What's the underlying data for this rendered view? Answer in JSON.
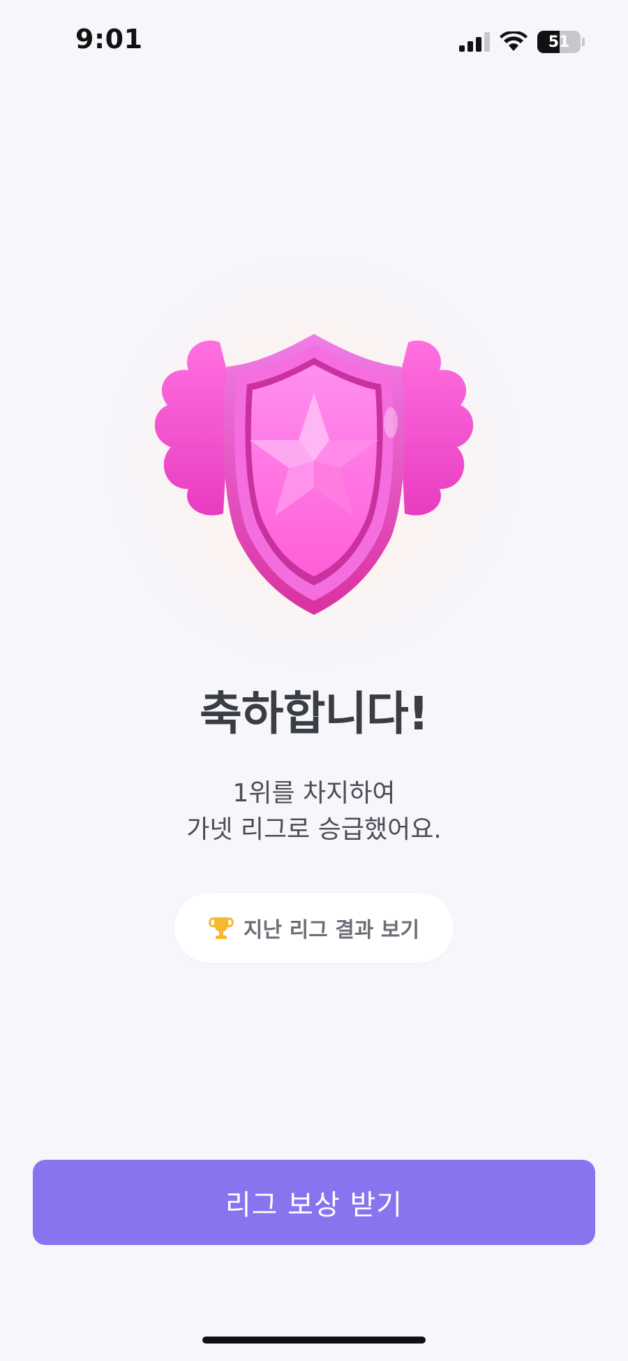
{
  "status_bar": {
    "time": "9:01",
    "battery_percent": "51",
    "battery_level": 0.51,
    "icons": [
      "cellular-signal-icon",
      "wifi-icon",
      "battery-icon"
    ]
  },
  "badge": {
    "icon": "pink-shield-star-badge",
    "color": "#f45fd5"
  },
  "title": "축하합니다!",
  "message": {
    "line1": "1위를 차지하여",
    "line2": "가넷 리그로 승급했어요."
  },
  "history_button": {
    "icon": "trophy-icon",
    "label": "지난 리그 결과 보기"
  },
  "primary_button": {
    "label": "리그 보상 받기",
    "color": "#8675ee"
  }
}
